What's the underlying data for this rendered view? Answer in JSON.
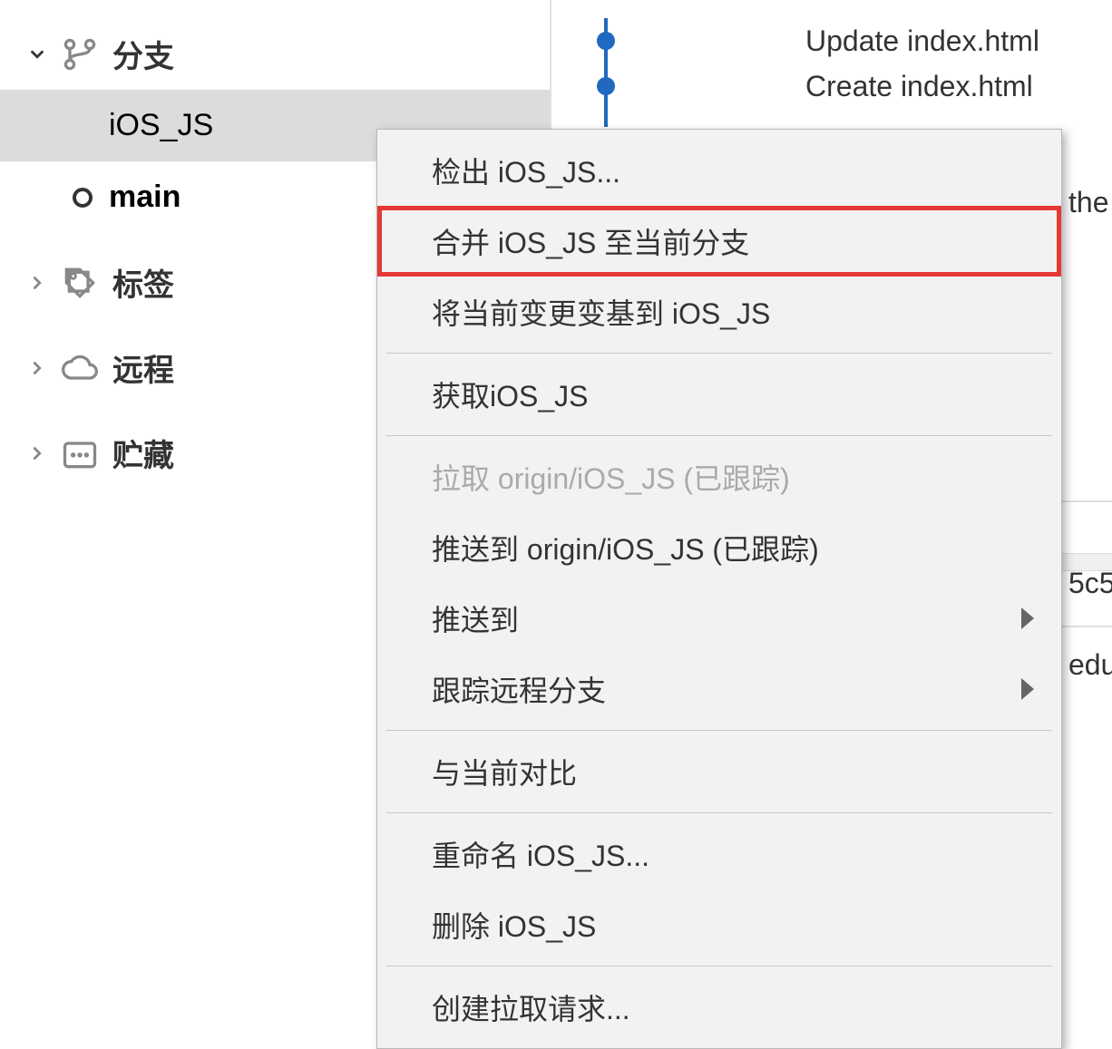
{
  "sidebar": {
    "branches": {
      "label": "分支",
      "items": [
        {
          "name": "iOS_JS",
          "selected": true,
          "bold": false,
          "hasCircle": false
        },
        {
          "name": "main",
          "selected": false,
          "bold": true,
          "hasCircle": true
        }
      ]
    },
    "tags": {
      "label": "标签"
    },
    "remote": {
      "label": "远程"
    },
    "stash": {
      "label": "贮藏"
    }
  },
  "commits": [
    {
      "msg": "Update index.html"
    },
    {
      "msg": "Create index.html"
    }
  ],
  "right_fragments": {
    "f1": "the",
    "f2": "5c5",
    "f3": "edu"
  },
  "context_menu": {
    "items": [
      {
        "label": "检出 iOS_JS...",
        "type": "item"
      },
      {
        "label": "合并 iOS_JS 至当前分支",
        "type": "item",
        "highlighted": true
      },
      {
        "label": "将当前变更变基到 iOS_JS",
        "type": "item"
      },
      {
        "type": "sep"
      },
      {
        "label": "获取iOS_JS",
        "type": "item"
      },
      {
        "type": "sep"
      },
      {
        "label": "拉取 origin/iOS_JS (已跟踪)",
        "type": "item",
        "disabled": true
      },
      {
        "label": "推送到 origin/iOS_JS (已跟踪)",
        "type": "item"
      },
      {
        "label": "推送到",
        "type": "item",
        "submenu": true
      },
      {
        "label": "跟踪远程分支",
        "type": "item",
        "submenu": true
      },
      {
        "type": "sep"
      },
      {
        "label": "与当前对比",
        "type": "item"
      },
      {
        "type": "sep"
      },
      {
        "label": "重命名 iOS_JS...",
        "type": "item"
      },
      {
        "label": "删除 iOS_JS",
        "type": "item"
      },
      {
        "type": "sep"
      },
      {
        "label": "创建拉取请求...",
        "type": "item"
      }
    ]
  }
}
